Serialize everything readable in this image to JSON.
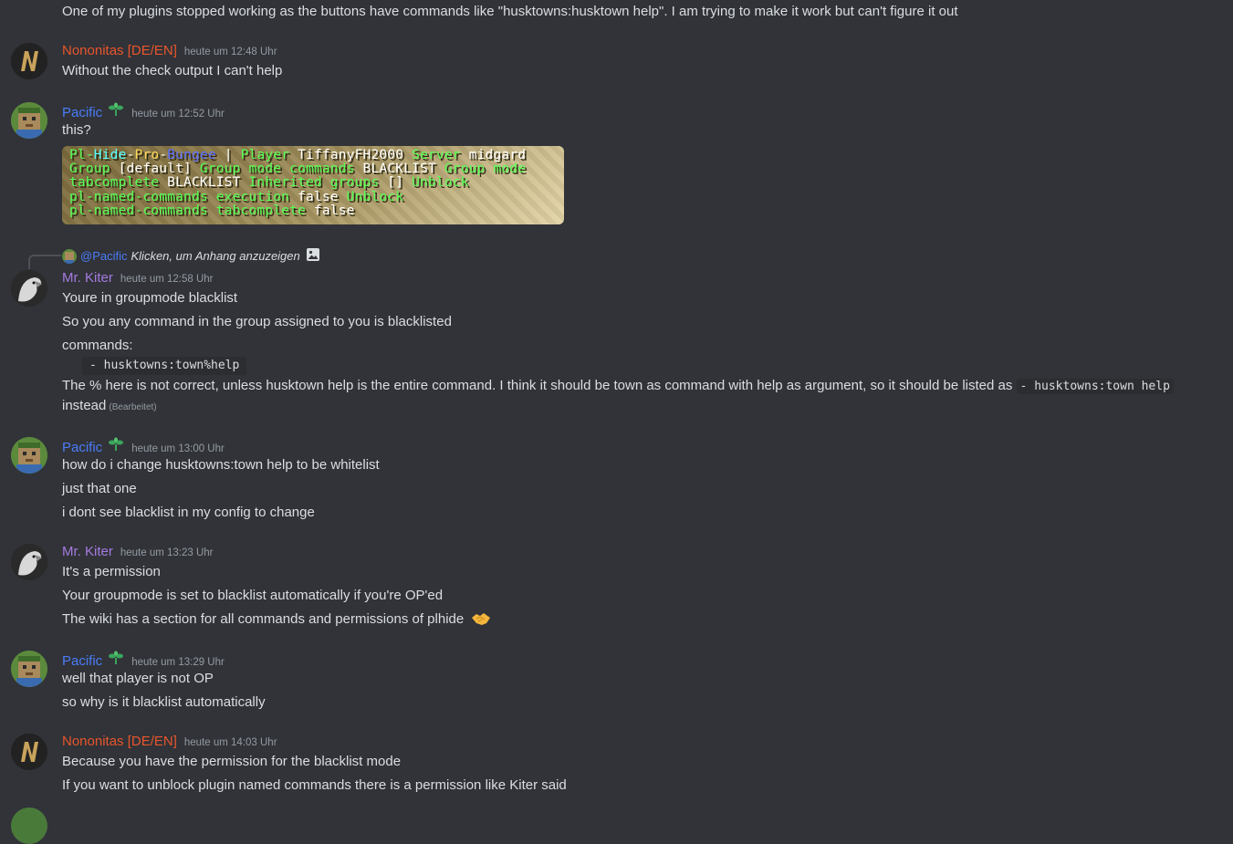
{
  "colors": {
    "background": "#313338",
    "nononitas": "#e8552b",
    "pacific": "#4a7cf7",
    "kiter": "#a57be0",
    "timestamp": "#949ba4",
    "text": "#dbdee1"
  },
  "top_line": "One of my plugins stopped working as the buttons have commands like \"husktowns:husktown help\". I am trying to make it work but can't figure it out",
  "m1": {
    "author": "Nononitas [DE/EN]",
    "time": "heute um 12:48 Uhr",
    "lines": [
      "Without the check output I can't help"
    ]
  },
  "m2": {
    "author": "Pacific",
    "time": "heute um 12:52 Uhr",
    "lines": [
      "this?"
    ],
    "image": {
      "row0a": "Pl-",
      "row0b": "Hide",
      "row0c": "-",
      "row0d": "Pro",
      "row0e": "-",
      "row0f": "Bungee",
      "row0g": " | ",
      "row0h": "Player ",
      "row0i": "TiffanyFH2000 ",
      "row0j": "Server ",
      "row0k": "midgard",
      "row1a": "Group ",
      "row1b": "[default] ",
      "row1c": "Group mode commands ",
      "row1d": "BLACKLIST ",
      "row1e": "Group mode",
      "row2a": "tabcomplete ",
      "row2b": "BLACKLIST ",
      "row2c": "Inherited groups ",
      "row2d": "[] ",
      "row2e": "Unblock",
      "row3a": "pl-named-commands execution ",
      "row3b": "false ",
      "row3c": "Unblock",
      "row4a": "pl-named-commands tabcomplete ",
      "row4b": "false"
    }
  },
  "m3": {
    "reply_mention": "@Pacific",
    "reply_text": "Klicken, um Anhang anzuzeigen",
    "reply_icon": "image-icon",
    "author": "Mr. Kiter",
    "time": "heute um 12:58 Uhr",
    "l1": "Youre in groupmode blacklist",
    "l2": "So you any command in the group assigned to you is blacklisted",
    "l3": "commands:",
    "code": "- husktowns:town%help",
    "l4": "The % here is not correct, unless husktown help is the entire command. I think it should be town as command with help as argument, so it should be listed as ",
    "l4_code": "- husktowns:town help",
    "l5": "instead",
    "edited": "(Bearbeitet)"
  },
  "m4": {
    "author": "Pacific",
    "time": "heute um 13:00 Uhr",
    "l1": "how do i change husktowns:town help to be whitelist",
    "l2": "just that one",
    "l3": "i dont see blacklist in my config to change"
  },
  "m5": {
    "author": "Mr. Kiter",
    "time": "heute um 13:23 Uhr",
    "l1": "It's a permission",
    "l2": "Your groupmode is set to blacklist automatically if you're OP'ed",
    "l3": "The wiki has a section for all commands and permissions of plhide",
    "l3_emoji": "handshake-emoji"
  },
  "m6": {
    "author": "Pacific",
    "time": "heute um 13:29 Uhr",
    "l1": "well that player is not OP",
    "l2": "so why is it blacklist automatically"
  },
  "m7": {
    "author": "Nononitas [DE/EN]",
    "time": "heute um 14:03 Uhr",
    "l1": "Because you have the permission for the blacklist mode",
    "l2": "If you want to unblock plugin named commands there is a permission like Kiter said"
  }
}
